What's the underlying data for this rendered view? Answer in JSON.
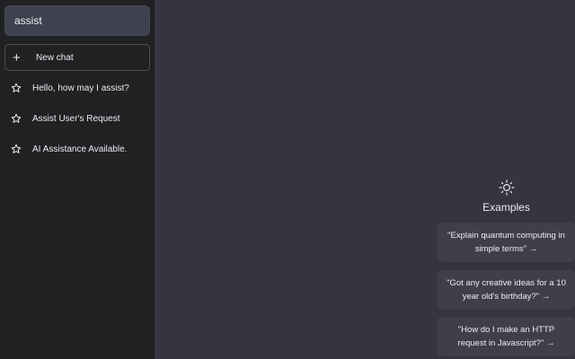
{
  "sidebar": {
    "search": {
      "value": "assist",
      "placeholder": ""
    },
    "new_chat": {
      "label": "New chat",
      "icon": "plus-icon"
    },
    "conversations": [
      {
        "label": "Hello, how may I assist?",
        "icon": "star-icon"
      },
      {
        "label": "Assist User's Request",
        "icon": "star-icon"
      },
      {
        "label": "AI Assistance Available.",
        "icon": "star-icon"
      }
    ]
  },
  "main": {
    "examples": {
      "icon": "sun-icon",
      "title": "Examples",
      "items": [
        "\"Explain quantum computing in simple terms\" →",
        "\"Got any creative ideas for a 10 year old's birthday?\" →",
        "\"How do I make an HTTP request in Javascript?\" →"
      ]
    }
  },
  "colors": {
    "sidebar_bg": "#202123",
    "main_bg": "#343541",
    "card_bg": "#3e3f4b",
    "text": "#ececf1"
  }
}
